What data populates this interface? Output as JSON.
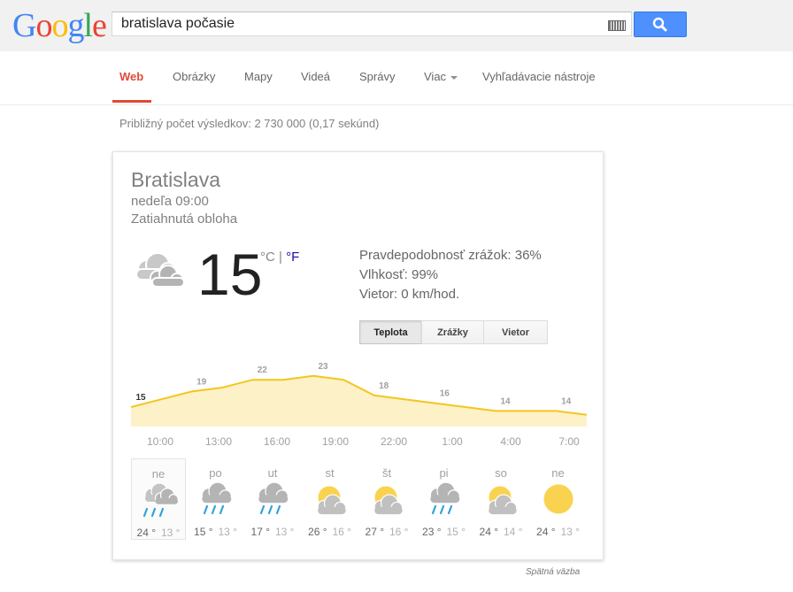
{
  "header": {
    "logo": "Google",
    "query": "bratislava počasie"
  },
  "nav": {
    "web": "Web",
    "images": "Obrázky",
    "maps": "Mapy",
    "videos": "Videá",
    "news": "Správy",
    "more": "Viac",
    "tools": "Vyhľadávacie nástroje"
  },
  "result_stats": "Približný počet výsledkov: 2 730 000 (0,17 sekúnd)",
  "weather": {
    "city": "Bratislava",
    "datetime": "nedeľa 09:00",
    "condition": "Zatiahnutá obloha",
    "temp": "15",
    "unit_c": "°C",
    "unit_sep": "|",
    "unit_f": "°F",
    "precip": "Pravdepodobnosť zrážok: 36%",
    "humidity": "Vlhkosť: 99%",
    "wind": "Vietor: 0 km/hod.",
    "tabs": [
      "Teplota",
      "Zrážky",
      "Vietor"
    ],
    "colors": {
      "line": "#f4c51f",
      "fill": "#fdf1c7",
      "sun": "#f9d34f",
      "rain": "#32a3d9",
      "cloud": "#b4b4b4"
    }
  },
  "chart_data": {
    "type": "area",
    "title": "",
    "hourly_temps": [
      15,
      17,
      19,
      20,
      22,
      22,
      23,
      22,
      18,
      17,
      16,
      15,
      14,
      14,
      14,
      13
    ],
    "labels": [
      {
        "index": 0,
        "value": "15"
      },
      {
        "index": 2,
        "value": "19"
      },
      {
        "index": 4,
        "value": "22"
      },
      {
        "index": 6,
        "value": "23"
      },
      {
        "index": 8,
        "value": "18"
      },
      {
        "index": 10,
        "value": "16"
      },
      {
        "index": 12,
        "value": "14"
      },
      {
        "index": 14,
        "value": "14"
      }
    ],
    "hours": [
      "10:00",
      "13:00",
      "16:00",
      "19:00",
      "22:00",
      "1:00",
      "4:00",
      "7:00"
    ],
    "ylim": [
      10,
      25
    ]
  },
  "forecast": [
    {
      "day": "ne",
      "hi": "24 °",
      "lo": "13 °",
      "icon": "cloud-rain-icon"
    },
    {
      "day": "po",
      "hi": "15 °",
      "lo": "13 °",
      "icon": "rain-icon"
    },
    {
      "day": "ut",
      "hi": "17 °",
      "lo": "13 °",
      "icon": "rain-icon"
    },
    {
      "day": "st",
      "hi": "26 °",
      "lo": "16 °",
      "icon": "partly-sunny-icon"
    },
    {
      "day": "št",
      "hi": "27 °",
      "lo": "16 °",
      "icon": "partly-sunny-icon"
    },
    {
      "day": "pi",
      "hi": "23 °",
      "lo": "15 °",
      "icon": "rain-icon"
    },
    {
      "day": "so",
      "hi": "24 °",
      "lo": "14 °",
      "icon": "partly-sunny-icon"
    },
    {
      "day": "ne",
      "hi": "24 °",
      "lo": "13 °",
      "icon": "sun-icon"
    }
  ],
  "feedback": "Spätná väzba"
}
